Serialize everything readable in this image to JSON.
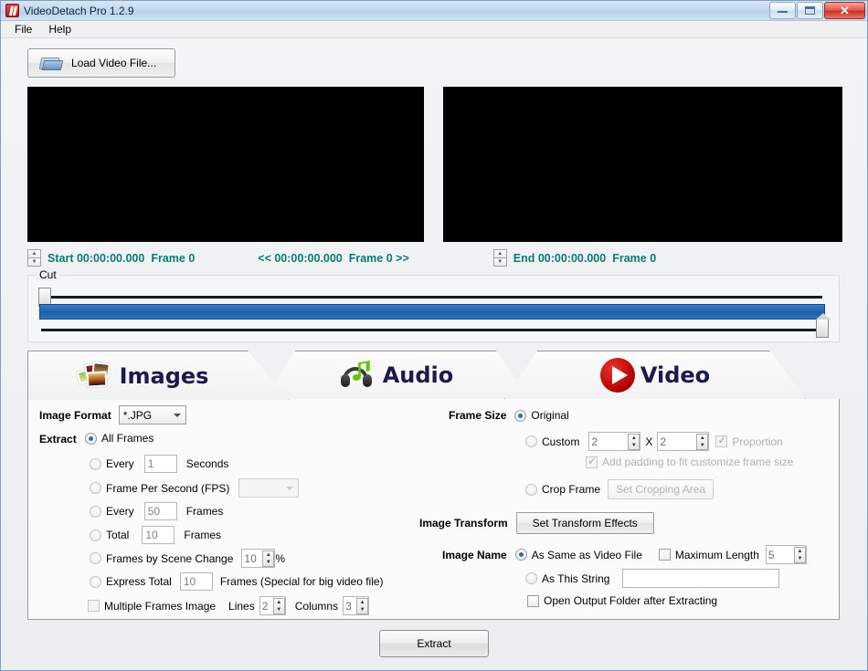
{
  "window": {
    "title": "VideoDetach Pro 1.2.9",
    "minimize_label": "Minimize",
    "maximize_label": "Maximize",
    "close_label": "✕"
  },
  "menubar": {
    "items": [
      "File",
      "Help"
    ]
  },
  "toolbar": {
    "load_video_label": "Load Video File..."
  },
  "timeline": {
    "start_label": "Start 00:00:00.000",
    "start_frame": "Frame 0",
    "prev_nav": "<< 00:00:00.000",
    "next_nav": "Frame 0 >>",
    "end_label": "End 00:00:00.000",
    "end_frame": "Frame 0",
    "cut_legend": "Cut",
    "accent_color": "#0c7a79",
    "bar_color": "#1c5fa8"
  },
  "tabs": [
    {
      "label": "Images",
      "icon": "photos-icon",
      "active": true
    },
    {
      "label": "Audio",
      "icon": "headphones-note-icon",
      "active": false
    },
    {
      "label": "Video",
      "icon": "play-circle-icon",
      "active": false
    }
  ],
  "images_tab": {
    "image_format_label": "Image Format",
    "image_format_value": "*.JPG",
    "extract_label": "Extract",
    "opt_all_frames": "All Frames",
    "opt_every_seconds": "Every",
    "every_seconds_value": "1",
    "seconds_unit": "Seconds",
    "opt_fps": "Frame Per Second (FPS)",
    "fps_value": "",
    "opt_every_frames": "Every",
    "every_frames_value": "50",
    "frames_unit": "Frames",
    "opt_total": "Total",
    "total_value": "10",
    "total_unit": "Frames",
    "opt_scene_change": "Frames by Scene Change",
    "scene_change_value": "10",
    "percent_unit": "%",
    "opt_express_total": "Express Total",
    "express_total_value": "10",
    "express_total_unit": "Frames (Special for big video file)",
    "multiple_frames_label": "Multiple Frames Image",
    "lines_label": "Lines",
    "lines_value": "2",
    "columns_label": "Columns",
    "columns_value": "3",
    "frame_size_label": "Frame Size",
    "opt_original": "Original",
    "opt_custom": "Custom",
    "custom_width": "2",
    "custom_x": "X",
    "custom_height": "2",
    "proportion_label": "Proportion",
    "padding_label": "Add padding to fit customize frame size",
    "opt_crop_frame": "Crop Frame",
    "set_cropping_area_label": "Set Cropping Area",
    "image_transform_label": "Image Transform",
    "set_transform_effects_label": "Set Transform Effects",
    "image_name_label": "Image Name",
    "opt_as_same_as_video": "As Same as Video File",
    "maximum_length_label": "Maximum Length",
    "maximum_length_value": "5",
    "opt_as_this_string": "As This String",
    "as_this_string_value": "",
    "open_output_folder_label": "Open Output Folder after Extracting"
  },
  "footer": {
    "extract_label": "Extract"
  }
}
